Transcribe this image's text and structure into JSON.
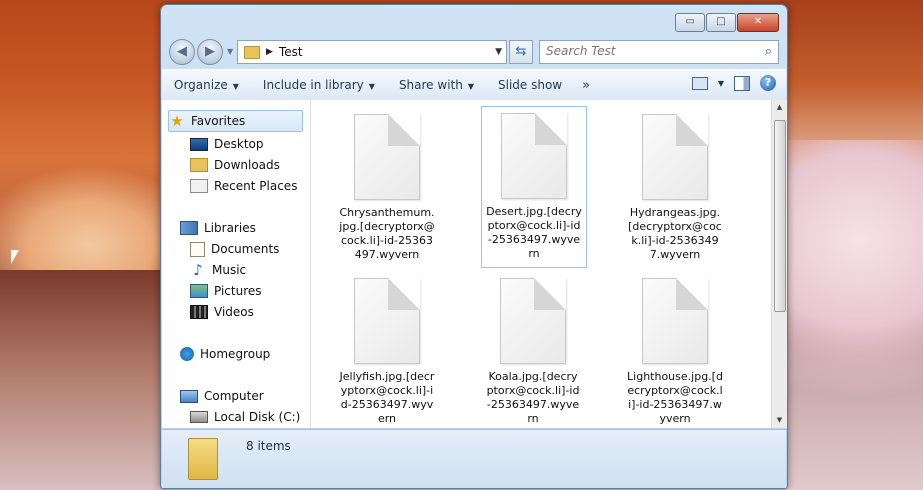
{
  "window": {
    "caption_buttons": {
      "minimize": "▭",
      "maximize": "□",
      "close": "✕"
    }
  },
  "navigation": {
    "back_glyph": "◀",
    "forward_glyph": "▶",
    "address_path": "Test",
    "search_placeholder": "Search Test"
  },
  "toolbar": {
    "items": [
      "Organize",
      "Include in library",
      "Share with",
      "Slide show"
    ],
    "more": "»"
  },
  "nav_pane": {
    "favorites": "Favorites",
    "desktop": "Desktop",
    "downloads": "Downloads",
    "recent_places": "Recent Places",
    "libraries": "Libraries",
    "documents": "Documents",
    "music": "Music",
    "pictures": "Pictures",
    "videos": "Videos",
    "homegroup": "Homegroup",
    "computer": "Computer",
    "local_disk": "Local Disk (C:)"
  },
  "files": [
    {
      "name": "Chrysanthemum.jpg.[decryptorx@cock.li]-id-25363497.wyvern"
    },
    {
      "name": "Desert.jpg.[decryptorx@cock.li]-id-25363497.wyvern"
    },
    {
      "name": "Hydrangeas.jpg.[decryptorx@cock.li]-id-25363497.wyvern"
    },
    {
      "name": "Jellyfish.jpg.[decryptorx@cock.li]-id-25363497.wyvern"
    },
    {
      "name": "Koala.jpg.[decryptorx@cock.li]-id-25363497.wyvern"
    },
    {
      "name": "Lighthouse.jpg.[decryptorx@cock.li]-id-25363497.wyvern"
    }
  ],
  "details": {
    "item_count": "8 items"
  },
  "colors": {
    "window_frame": "#b9d3ec",
    "selection_border": "#9dc3ea",
    "toolbar_text": "#1e395b"
  }
}
